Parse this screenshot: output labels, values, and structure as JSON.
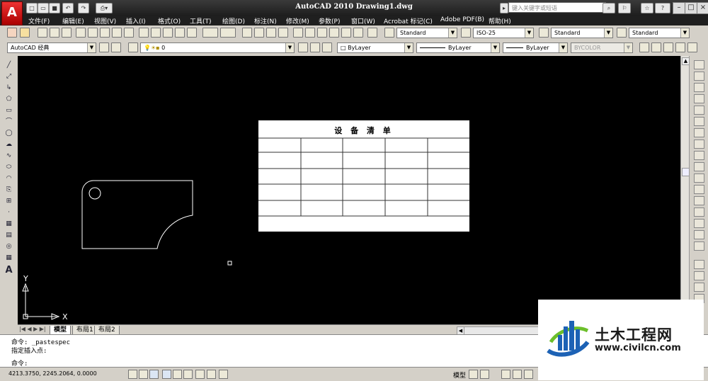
{
  "title_bar": {
    "title": "AutoCAD 2010  Drawing1.dwg",
    "search_placeholder": "键入关键字或短语"
  },
  "menu": [
    "文件(F)",
    "编辑(E)",
    "视图(V)",
    "插入(I)",
    "格式(O)",
    "工具(T)",
    "绘图(D)",
    "标注(N)",
    "修改(M)",
    "参数(P)",
    "窗口(W)",
    "Acrobat 标记(C)",
    "Adobe PDF(B)",
    "帮助(H)"
  ],
  "styles_toolbar": {
    "text_style": "Standard",
    "dim_style": "ISO-25",
    "table_style": "Standard",
    "multileader_style": "Standard"
  },
  "layers_toolbar": {
    "workspace": "AutoCAD 经典",
    "layer": "0",
    "color": "ByLayer",
    "linetype": "ByLayer",
    "lineweight": "ByLayer",
    "plot_style": "BYCOLOR"
  },
  "drawing": {
    "table_title": "设 备 清 单",
    "table_rows": 5,
    "table_cols": 5,
    "ucs_x": "X",
    "ucs_y": "Y"
  },
  "tabs": [
    "模型",
    "布局1",
    "布局2"
  ],
  "command_lines": [
    "命令:  _pastespec",
    "指定插入点:",
    "命令:"
  ],
  "status": {
    "coordinates": "4213.3750, 2245.2064, 0.0000",
    "model_label": "模型"
  },
  "watermark": {
    "name": "土木工程网",
    "url": "www.civilcn.com"
  },
  "colors": {
    "canvas": "#000000",
    "chrome": "#d4d0c8",
    "title_bar": "#1f1f1f",
    "logo_red": "#cc1111",
    "watermark_blue": "#1d62b5"
  }
}
